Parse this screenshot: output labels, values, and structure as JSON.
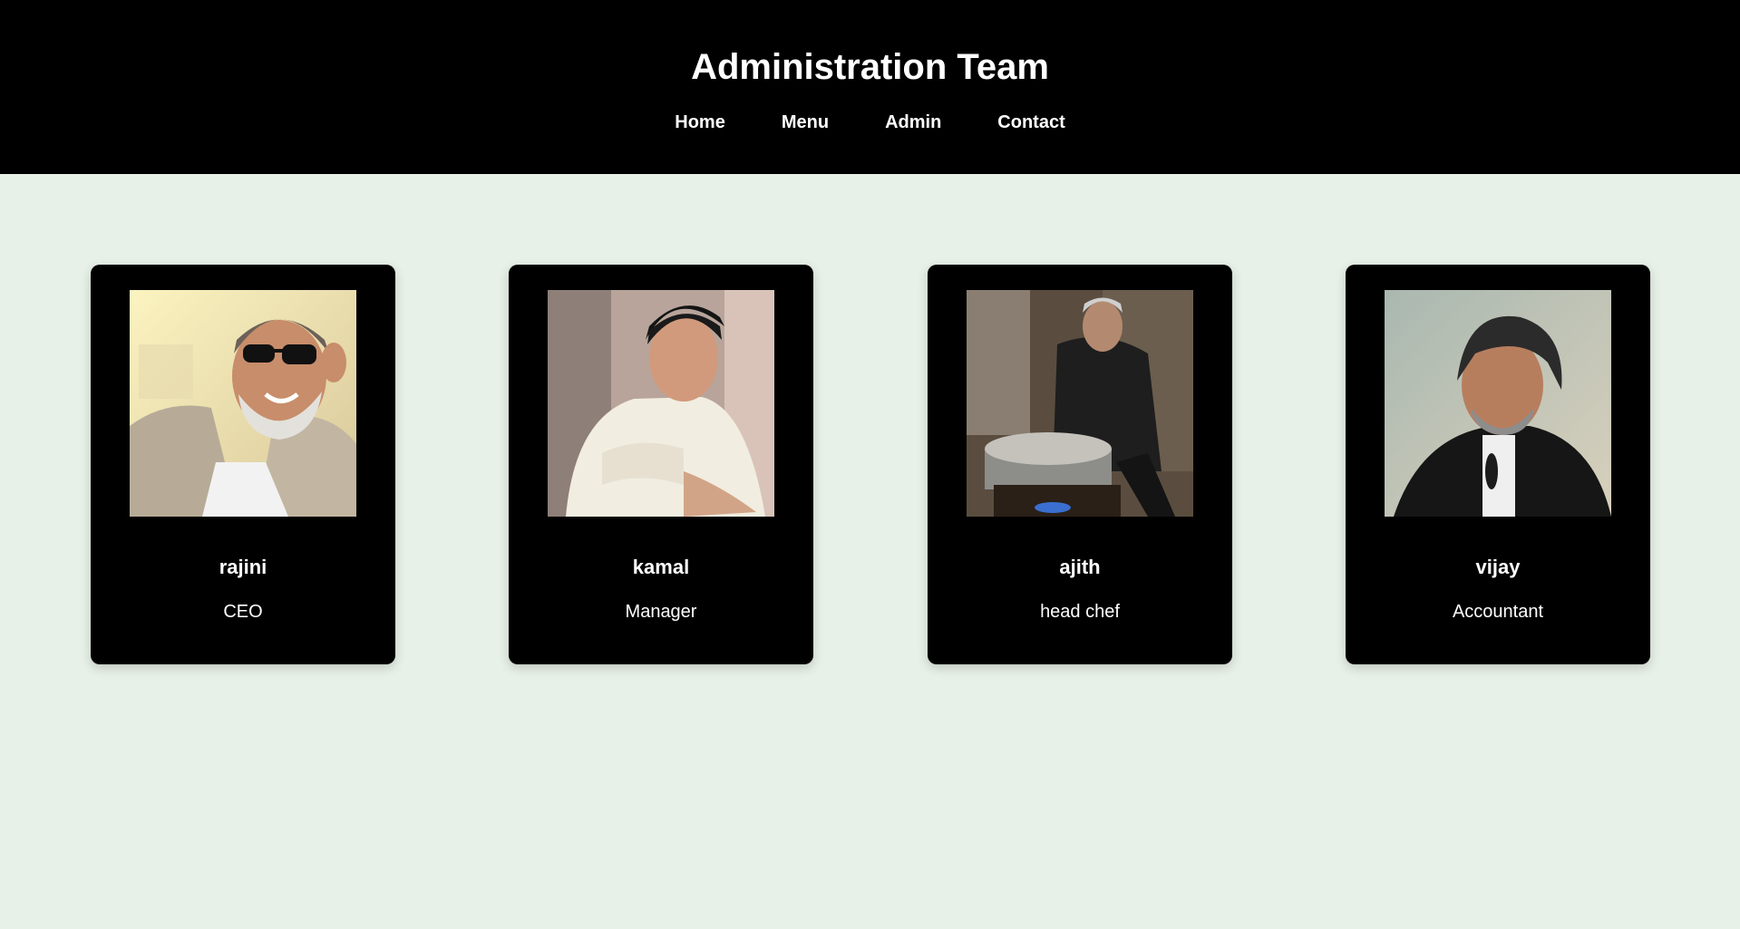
{
  "header": {
    "title": "Administration Team",
    "nav": [
      "Home",
      "Menu",
      "Admin",
      "Contact"
    ]
  },
  "team": [
    {
      "name": "rajini",
      "role": "CEO"
    },
    {
      "name": "kamal",
      "role": "Manager"
    },
    {
      "name": "ajith",
      "role": "head chef"
    },
    {
      "name": "vijay",
      "role": "Accountant"
    }
  ],
  "colors": {
    "header_bg": "#000000",
    "page_bg": "#e8f1e8",
    "card_bg": "#000000",
    "text": "#ffffff"
  }
}
